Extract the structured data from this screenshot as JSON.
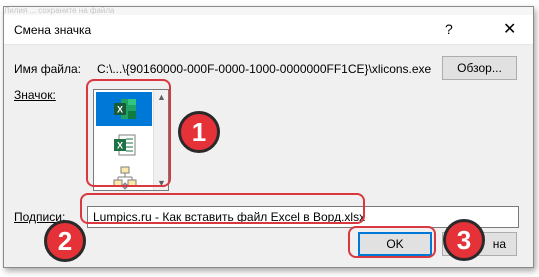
{
  "window": {
    "bg_text": "Лилия ... сохраните на файла",
    "title": "Смена значка",
    "help_icon": "?",
    "close_icon": "✕"
  },
  "file": {
    "label": "Имя файла:",
    "path": "C:\\...\\{90160000-000F-0000-1000-0000000FF1CE}\\xlicons.exe",
    "browse_label": "Обзор..."
  },
  "icon": {
    "label": "Значок:",
    "items": [
      "excel-app-icon",
      "excel-sheet-icon",
      "org-chart-icon"
    ]
  },
  "caption": {
    "label": "Подписи:",
    "value": "Lumpics.ru - Как вставить файл Excel в Ворд.xlsx"
  },
  "buttons": {
    "ok_label": "OK",
    "cancel_partial": "на"
  },
  "annotations": {
    "step1": "1",
    "step2": "2",
    "step3": "3"
  },
  "colors": {
    "highlight": "#d9383e",
    "badge": "#e53238",
    "selection": "#0078d7",
    "excel_green": "#1e7145"
  }
}
